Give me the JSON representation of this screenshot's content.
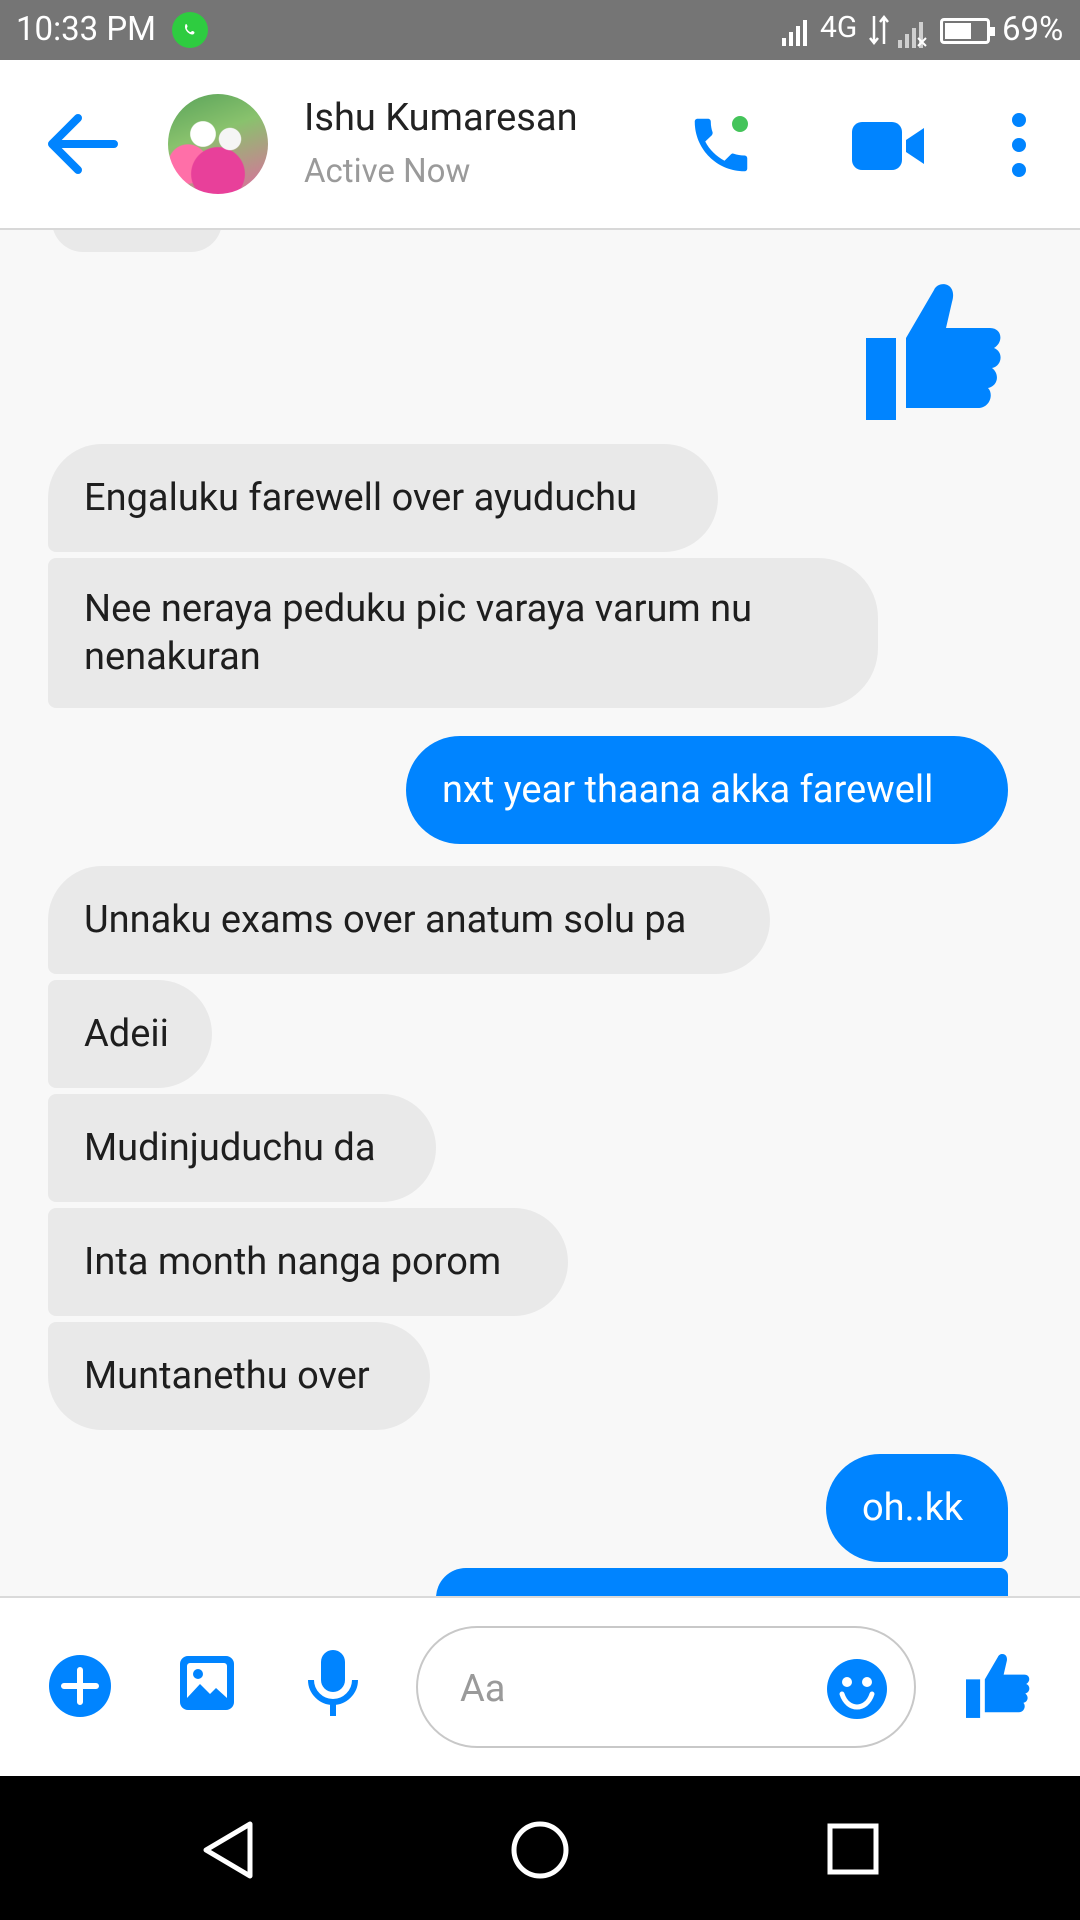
{
  "status_bar": {
    "time": "10:33 PM",
    "network": "4G",
    "battery_pct": "69%"
  },
  "header": {
    "contact_name": "Ishu Kumaresan",
    "contact_status": "Active Now",
    "accent_color": "#0084ff"
  },
  "messages": [
    {
      "from": "them",
      "text": "Engaluku farewell over ayuduchu"
    },
    {
      "from": "them",
      "text": "Nee neraya peduku pic varaya varum nu nenakuran"
    },
    {
      "from": "me",
      "text": "nxt year thaana akka farewell"
    },
    {
      "from": "them",
      "text": "Unnaku exams over anatum solu pa"
    },
    {
      "from": "them",
      "text": "Adeii"
    },
    {
      "from": "them",
      "text": "Mudinjuduchu da"
    },
    {
      "from": "them",
      "text": "Inta month nanga porom"
    },
    {
      "from": "them",
      "text": "Muntanethu over"
    },
    {
      "from": "me",
      "text": "oh..kk"
    }
  ],
  "composer": {
    "placeholder": "Aa"
  },
  "icons": [
    "back-arrow-icon",
    "phone-icon",
    "video-camera-icon",
    "more-vertical-icon",
    "thumbs-up-icon",
    "plus-icon",
    "image-icon",
    "microphone-icon",
    "emoji-icon",
    "nav-back-icon",
    "nav-home-icon",
    "nav-recents-icon"
  ]
}
